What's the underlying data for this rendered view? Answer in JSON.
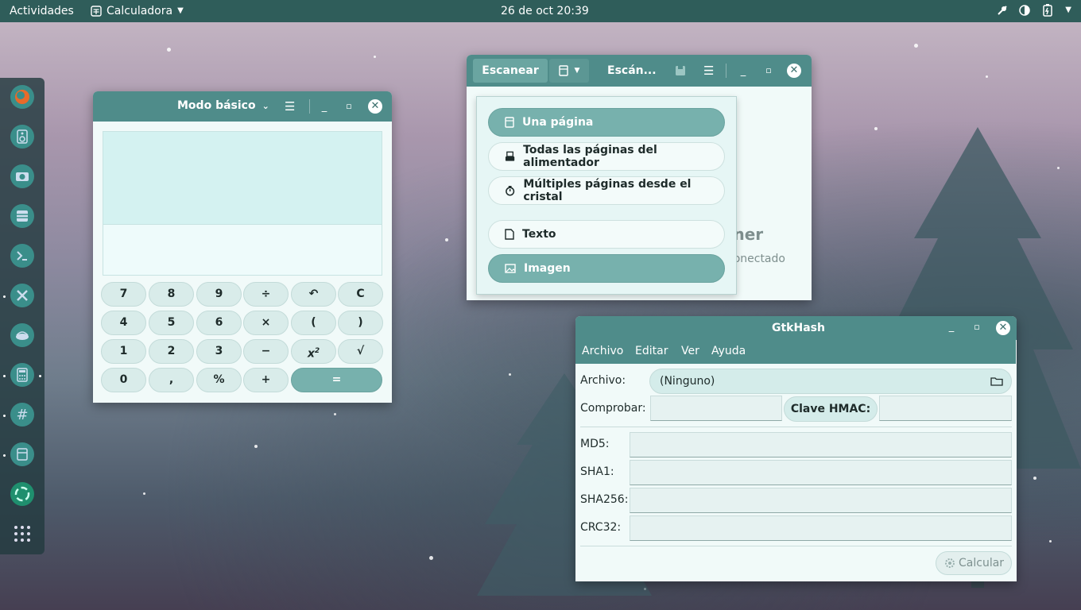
{
  "topbar": {
    "activities": "Actividades",
    "app_name": "Calculadora",
    "clock": "26 de oct  20:39"
  },
  "dock": {
    "items": [
      "firefox-icon",
      "speaker-icon",
      "camera-icon",
      "files-icon",
      "terminal-icon",
      "tools-icon",
      "lamp-icon",
      "calculator-icon",
      "hash-icon",
      "scanner-icon",
      "recycle-icon",
      "app-grid-icon"
    ]
  },
  "calculator": {
    "mode": "Modo básico",
    "keys": [
      [
        "7",
        "8",
        "9",
        "÷",
        "↶",
        "C"
      ],
      [
        "4",
        "5",
        "6",
        "×",
        "(",
        ")"
      ],
      [
        "1",
        "2",
        "3",
        "−",
        "x2",
        "√"
      ],
      [
        "0",
        ",",
        "%",
        "+",
        "="
      ]
    ]
  },
  "scanner": {
    "scan_button": "Escanear",
    "title": "Escán...",
    "menu": [
      "Una página",
      "Todas las páginas del alimentador",
      "Múltiples páginas desde el cristal",
      "Texto",
      "Imagen"
    ],
    "bg_title_fragment": "áner",
    "bg_subtitle_fragment": "conectado"
  },
  "gtkhash": {
    "title": "GtkHash",
    "menu": [
      "Archivo",
      "Editar",
      "Ver",
      "Ayuda"
    ],
    "file_label": "Archivo:",
    "file_value": "(Ninguno)",
    "check_label": "Comprobar:",
    "hmac_button": "Clave HMAC:",
    "hashes": [
      "MD5:",
      "SHA1:",
      "SHA256:",
      "CRC32:"
    ],
    "calc_button": "Calcular"
  },
  "colors": {
    "accent": "#4f8c8a",
    "topbar": "#2f5d5a",
    "selected": "#77b1ad"
  }
}
